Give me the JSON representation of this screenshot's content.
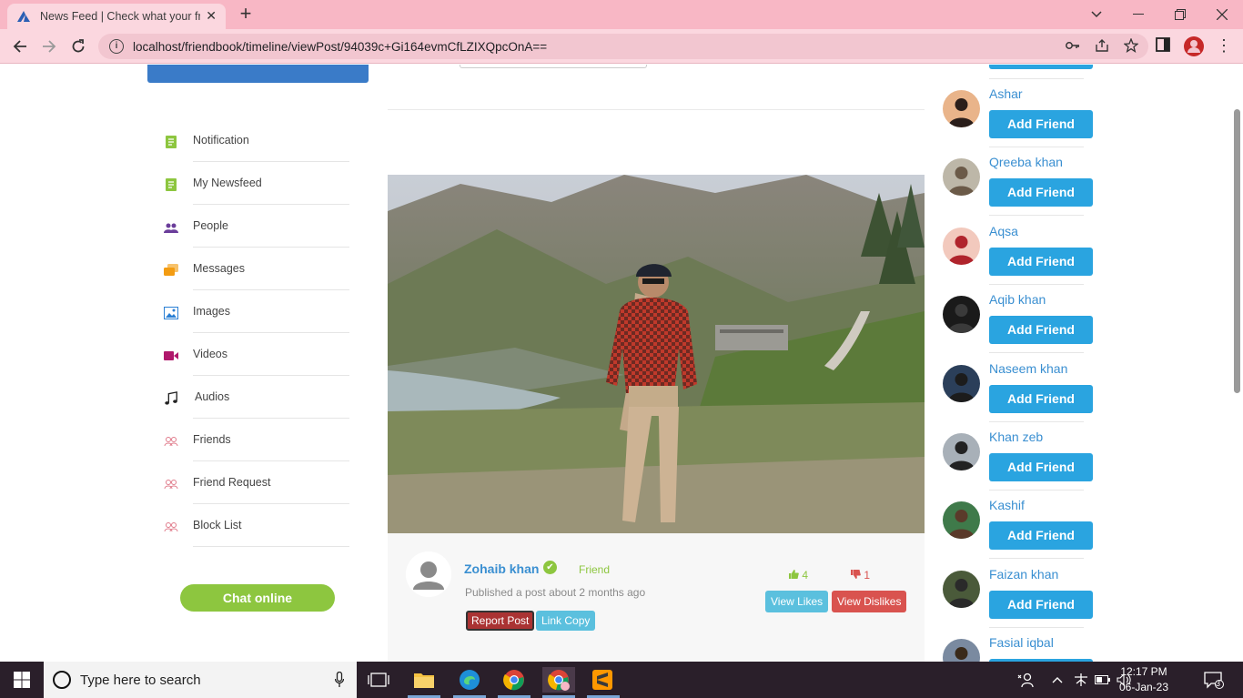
{
  "browser": {
    "tab_title": "News Feed | Check what your frie",
    "url": "localhost/friendbook/timeline/viewPost/94039c+Gi164evmCfLZIXQpcOnA=="
  },
  "sidebar": {
    "items": [
      {
        "label": "Notification",
        "icon": "notification-icon",
        "color": "#8dc63f"
      },
      {
        "label": "My Newsfeed",
        "icon": "newsfeed-icon",
        "color": "#8dc63f"
      },
      {
        "label": "People",
        "icon": "people-icon",
        "color": "#6a3d9a"
      },
      {
        "label": "Messages",
        "icon": "messages-icon",
        "color": "#f39c12"
      },
      {
        "label": "Images",
        "icon": "images-icon",
        "color": "#2a7fd4"
      },
      {
        "label": "Videos",
        "icon": "videos-icon",
        "color": "#b0186c"
      },
      {
        "label": "Audios",
        "icon": "music-note-icon",
        "color": "#222222"
      },
      {
        "label": "Friends",
        "icon": "friends-icon",
        "color": "#e07a8a"
      },
      {
        "label": "Friend Request",
        "icon": "friend-request-icon",
        "color": "#e07a8a"
      },
      {
        "label": "Block List",
        "icon": "block-list-icon",
        "color": "#e07a8a"
      }
    ],
    "chat_button": "Chat online"
  },
  "post": {
    "author": "Zohaib khan",
    "relation": "Friend",
    "published": "Published a post about 2 months ago",
    "report_label": "Report Post",
    "link_copy_label": "Link Copy",
    "likes": "4",
    "dislikes": "1",
    "view_likes_label": "View Likes",
    "view_dislikes_label": "View Dislikes"
  },
  "suggestions": {
    "button_label": "Add Friend",
    "people": [
      {
        "name": "Ashar"
      },
      {
        "name": "Qreeba khan"
      },
      {
        "name": "Aqsa"
      },
      {
        "name": "Aqib khan"
      },
      {
        "name": "Naseem khan"
      },
      {
        "name": "Khan zeb"
      },
      {
        "name": "Kashif"
      },
      {
        "name": "Faizan khan"
      },
      {
        "name": "Fasial iqbal"
      }
    ]
  },
  "taskbar": {
    "search_placeholder": "Type here to search",
    "time": "12:17 PM",
    "date": "06-Jan-23",
    "notification_count": "3"
  },
  "colors": {
    "accent_blue": "#2aa4e0",
    "accent_green": "#8dc63f",
    "danger": "#d9534f",
    "chrome_pink": "#f8b7c5"
  }
}
